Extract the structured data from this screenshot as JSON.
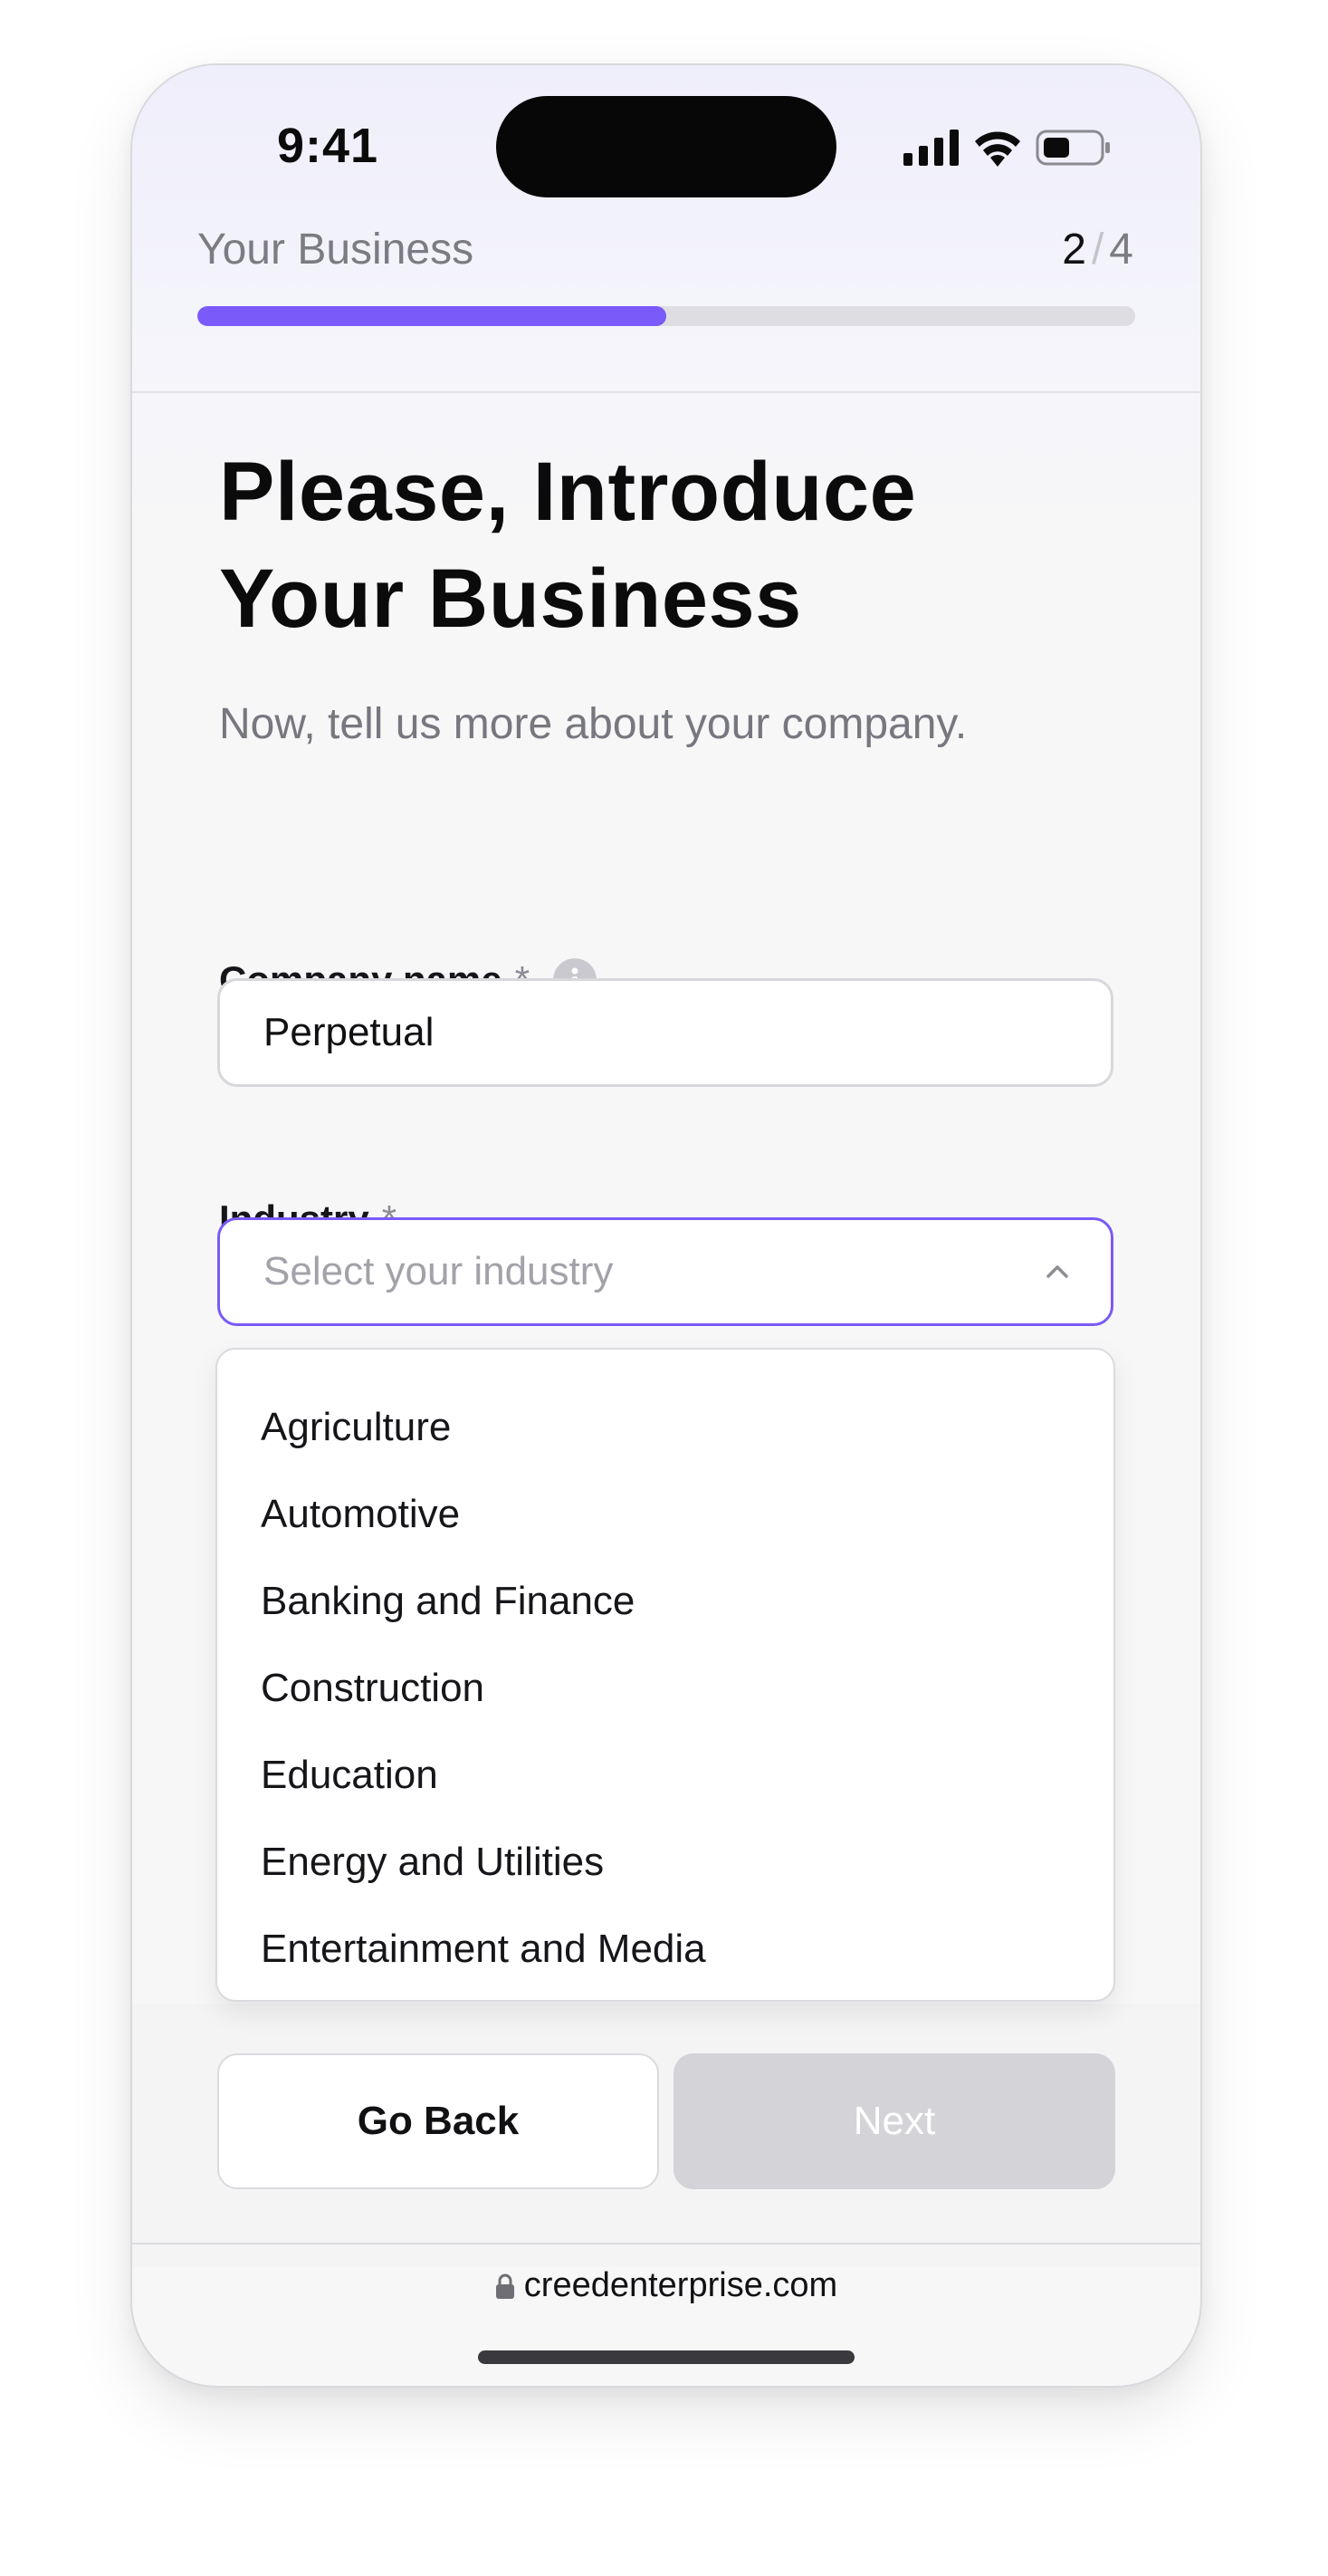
{
  "status_bar": {
    "time": "9:41"
  },
  "progress": {
    "title": "Your Business",
    "current": "2",
    "separator": "/",
    "total": "4",
    "fraction": 0.5
  },
  "form": {
    "heading_line1": "Please, Introduce",
    "heading_line2": "Your Business",
    "subheading": "Now, tell us more about your company.",
    "company_label": "Company name",
    "company_required": "*",
    "company_value": "Perpetual",
    "industry_label": "Industry",
    "industry_required": "*",
    "industry_placeholder": "Select your industry"
  },
  "industry_options": [
    "Agriculture",
    "Automotive",
    "Banking and Finance",
    "Construction",
    "Education",
    "Energy and Utilities",
    "Entertainment and Media"
  ],
  "actions": {
    "back_label": "Go Back",
    "next_label": "Next"
  },
  "browser": {
    "url": "creedenterprise.com"
  },
  "colors": {
    "accent": "#7a5af8",
    "disabled": "#d4d4d8"
  }
}
